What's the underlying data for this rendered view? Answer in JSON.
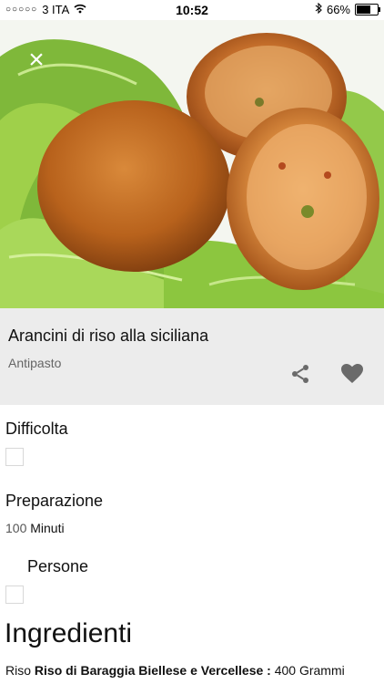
{
  "status_bar": {
    "carrier": "3 ITA",
    "time": "10:52",
    "battery": "66%",
    "battery_level": 0.66
  },
  "recipe": {
    "title": "Arancini di riso alla siciliana",
    "category": "Antipasto"
  },
  "details": {
    "difficulty_label": "Difficolta",
    "preparation_label": "Preparazione",
    "preparation_value": "100",
    "preparation_unit": "Minuti",
    "servings_label": "Persone"
  },
  "ingredients": {
    "heading": "Ingredienti",
    "items": [
      {
        "type": "Riso",
        "name": "Riso di Baraggia Biellese e Vercellese :",
        "quantity": "400 Grammi"
      }
    ]
  },
  "icons": {
    "close": "close-icon",
    "share": "share-icon",
    "favorite": "heart-icon",
    "wifi": "wifi-icon",
    "bluetooth": "bluetooth-icon",
    "battery": "battery-icon"
  },
  "colors": {
    "panel_bg": "#ececec",
    "icon_gray": "#6a6a6a"
  }
}
